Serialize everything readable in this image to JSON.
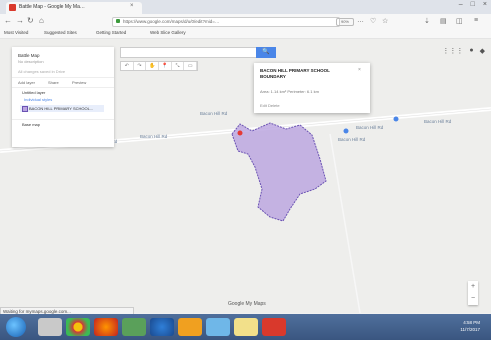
{
  "browser": {
    "tab_title": "Battle Map - Google My Ma…",
    "tab_close": "×",
    "controls": {
      "minimize": "–",
      "maximize": "□",
      "close": "×"
    },
    "nav": {
      "back": "←",
      "forward": "→",
      "reload": "↻",
      "home": "⌂"
    },
    "url": "https://www.google.com/maps/d/u/0/edit?mid=…",
    "zoom": "90%",
    "toolbar_icons": [
      "…",
      "♡",
      "☆"
    ],
    "right_icons": [
      "⇣",
      "▤",
      "◫",
      "≡"
    ]
  },
  "bookmarks": {
    "items": [
      "Most Visited",
      "Suggested Sites",
      "Getting Started",
      "Web Slice Gallery"
    ]
  },
  "map": {
    "search_button": "🔍",
    "tools": [
      "↶",
      "↷",
      "✋",
      "📍",
      "⤡",
      "▭"
    ],
    "top_controls": [
      "⋮⋮⋮",
      "●",
      "◆"
    ],
    "panel": {
      "title": "Battle Map",
      "subtitle": "No description",
      "meta": "All changes saved in Drive",
      "actions": [
        "Add layer",
        "Share",
        "Preview"
      ],
      "layer_title": "Untitled layer",
      "layer_style": "Individual styles",
      "layer_item": "BACON HILL PRIMARY SCHOOL...",
      "base_map": "Base map"
    },
    "info_card": {
      "title": "BACON HILL PRIMARY SCHOOL BOUNDARY",
      "description": "Area: 1.14 km²  Perimeter: 6.1 km",
      "footer": "Edit   Delete"
    },
    "road_labels": [
      "Bacon Hill Rd",
      "Bacon Hill Rd",
      "Bacon Hill Rd",
      "Bacon Hill Rd",
      "Bacon Hill Rd",
      "Bacon Hill Rd",
      "Bacon Hill Rd"
    ],
    "google_logo": "Google My Maps",
    "zoom_in": "+",
    "zoom_out": "−",
    "polygon_color": "#b9a3e0",
    "polygon_stroke": "#6a52b3"
  },
  "status": "Waiting for mymaps.google.com...",
  "taskbar": {
    "clock_time": "4:58 PM",
    "clock_date": "11/7/2017"
  }
}
